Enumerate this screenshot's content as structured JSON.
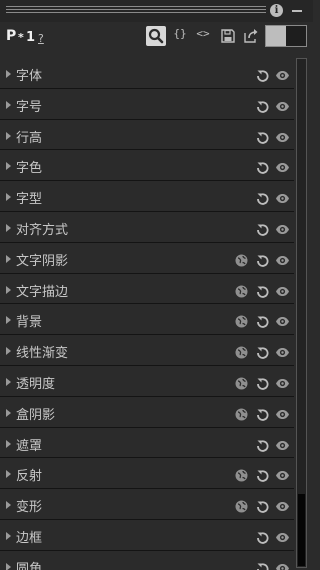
{
  "toolbar": {
    "p": "P",
    "star": "*",
    "one": "1",
    "help": "?",
    "braces": "{}",
    "code": "<>"
  },
  "rows": [
    {
      "label": "字体",
      "globe": false
    },
    {
      "label": "字号",
      "globe": false
    },
    {
      "label": "行高",
      "globe": false
    },
    {
      "label": "字色",
      "globe": false
    },
    {
      "label": "字型",
      "globe": false
    },
    {
      "label": "对齐方式",
      "globe": false
    },
    {
      "label": "文字阴影",
      "globe": true
    },
    {
      "label": "文字描边",
      "globe": true
    },
    {
      "label": "背景",
      "globe": true
    },
    {
      "label": "线性渐变",
      "globe": true
    },
    {
      "label": "透明度",
      "globe": true
    },
    {
      "label": "盒阴影",
      "globe": true
    },
    {
      "label": "遮罩",
      "globe": false
    },
    {
      "label": "反射",
      "globe": true
    },
    {
      "label": "变形",
      "globe": true
    },
    {
      "label": "边框",
      "globe": false
    },
    {
      "label": "圆角",
      "globe": false
    }
  ]
}
